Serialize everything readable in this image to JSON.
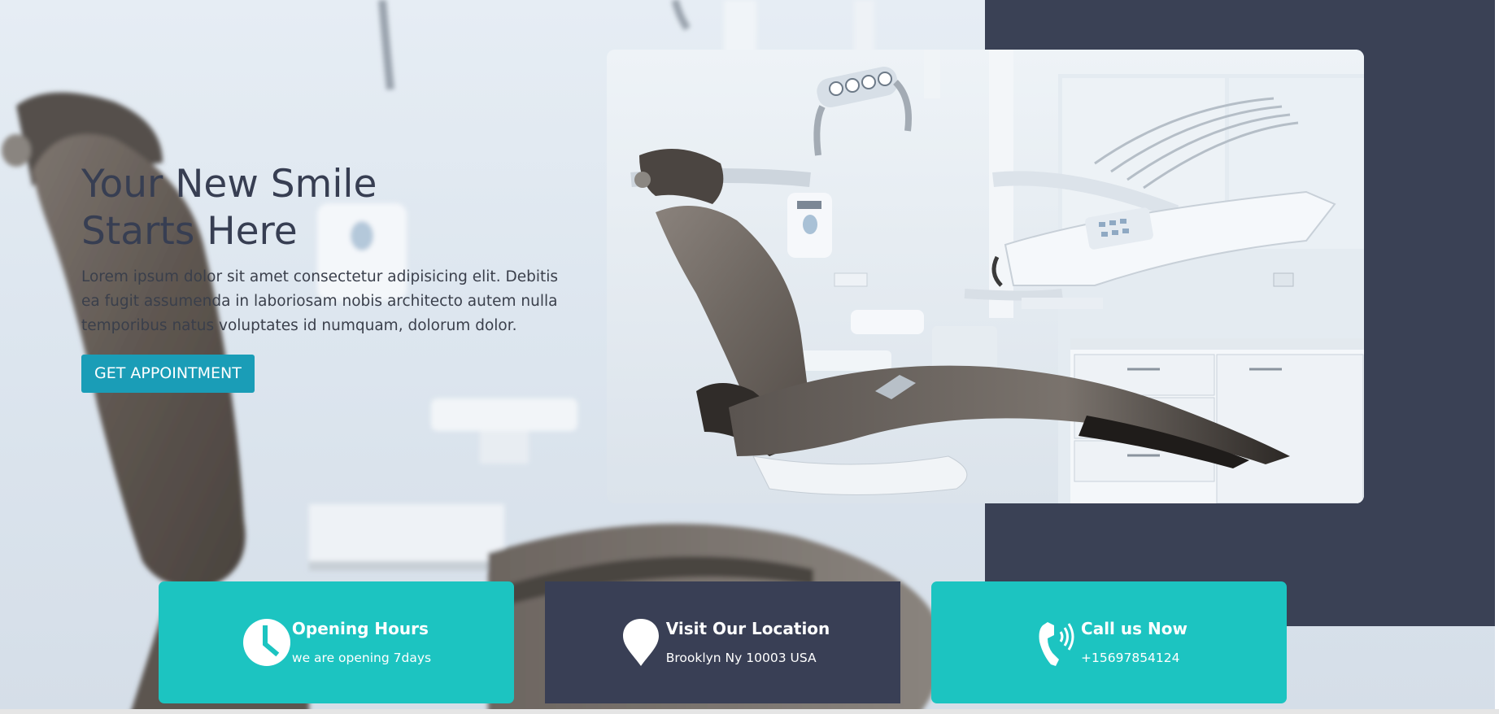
{
  "hero": {
    "title": "Your New Smile Starts Here",
    "description": "Lorem ipsum dolor sit amet consectetur adipisicing elit. Debitis ea fugit assumenda in laboriosam nobis architecto autem nulla temporibus natus voluptates id numquam, dolorum dolor.",
    "cta_label": "GET APPOINTMENT"
  },
  "info_boxes": [
    {
      "icon": "clock-icon",
      "title": "Opening Hours",
      "subtitle": "we are opening 7days"
    },
    {
      "icon": "location-pin-icon",
      "title": "Visit Our Location",
      "subtitle": "Brooklyn Ny 10003 USA"
    },
    {
      "icon": "phone-icon",
      "title": "Call us Now",
      "subtitle": "+15697854124"
    }
  ],
  "colors": {
    "navy": "#3a4155",
    "teal": "#1cc4c1",
    "cta": "#1a9db7",
    "title_text": "#373e52"
  }
}
